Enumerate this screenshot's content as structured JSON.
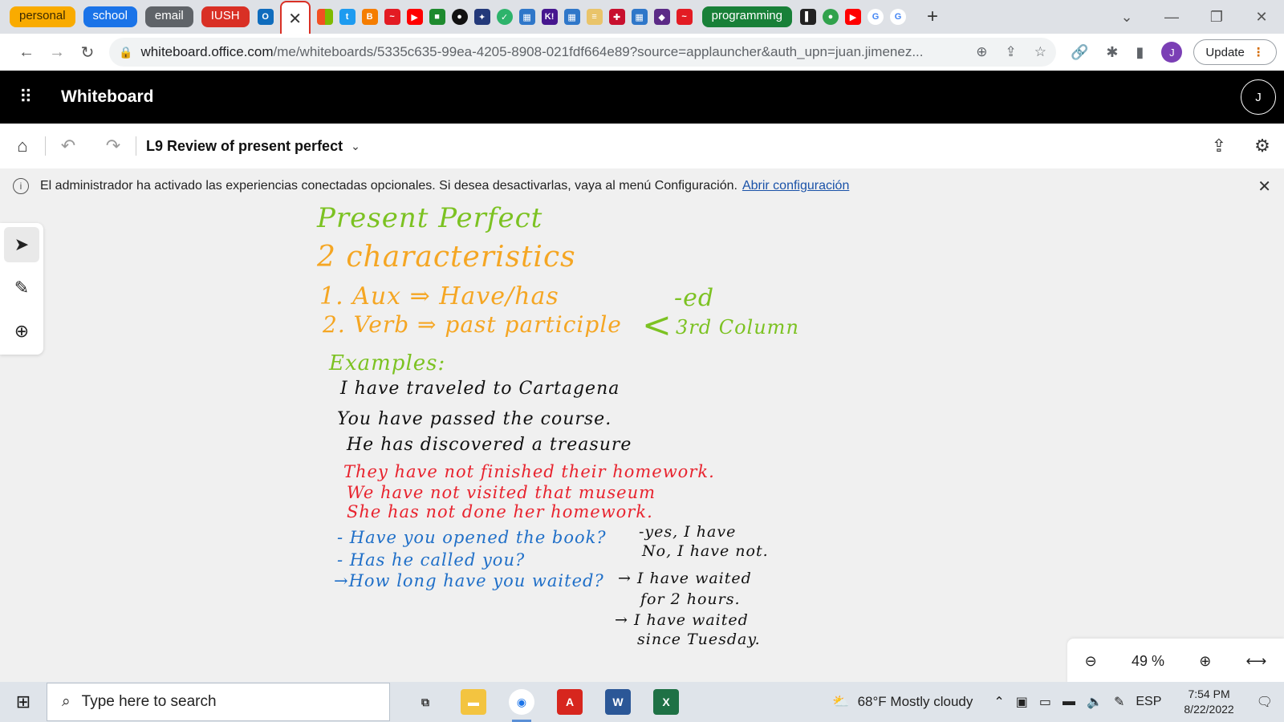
{
  "browser": {
    "tab_groups": [
      {
        "label": "personal",
        "color": "#f9ab00",
        "text": "#3c2a00"
      },
      {
        "label": "school",
        "color": "#1a73e8",
        "text": "#ffffff"
      },
      {
        "label": "email",
        "color": "#5f6368",
        "text": "#ffffff"
      },
      {
        "label": "IUSH",
        "color": "#d93025",
        "text": "#ffffff"
      },
      {
        "label": "programming",
        "color": "#188038",
        "text": "#ffffff"
      }
    ],
    "active_tab_close": "✕",
    "new_tab": "+",
    "url_host": "whiteboard.office.com",
    "url_path": "/me/whiteboards/5335c635-99ea-4205-8908-021fdf664e89?source=applauncher&auth_upn=juan.jimenez...",
    "profile_initial": "J",
    "update_label": "Update"
  },
  "app": {
    "title": "Whiteboard",
    "user_initial": "J",
    "document_title": "L9 Review of present perfect"
  },
  "notice": {
    "text": "El administrador ha activado las experiencias conectadas opcionales. Si desea desactivarlas, vaya al menú Configuración.",
    "link": "Abrir configuración"
  },
  "board": {
    "title": "Present Perfect",
    "subtitle": "2 characteristics",
    "rule1": "1. Aux ⇒ Have/has",
    "rule2": "2. Verb ⇒ past participle",
    "branch1": "-ed",
    "branch2": "3rd Column",
    "examples_label": "Examples:",
    "ex1": "I have traveled to Cartagena",
    "ex2": "You have passed the course.",
    "ex3": "He has discovered a treasure",
    "neg1": "They have not finished their homework.",
    "neg2": "We have not visited that museum",
    "neg3": "She has not done her homework.",
    "q1": "- Have you opened the book?",
    "a1a": "-yes, I have",
    "a1b": "No, I have not.",
    "q2": "- Has he called you?",
    "q3": "→How long have you waited?",
    "a3a": "→ I have waited",
    "a3b": "for 2 hours.",
    "a3c": "→ I have waited",
    "a3d": "since Tuesday."
  },
  "zoom": {
    "level": "49 %"
  },
  "taskbar": {
    "search_placeholder": "Type here to search",
    "weather": "68°F  Mostly cloudy",
    "language": "ESP",
    "time": "7:54 PM",
    "date": "8/22/2022"
  }
}
